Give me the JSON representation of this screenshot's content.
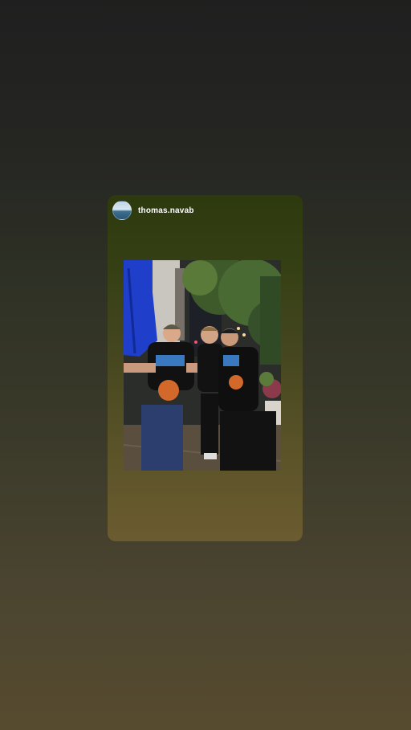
{
  "story": {
    "username": "thomas.navab",
    "avatar_icon": "ocean-avatar-icon",
    "photo_description_icon": "group-photo-image"
  },
  "colors": {
    "background_top": "#1f1f1f",
    "background_bottom": "#574b2f",
    "card_top": "#2d3a0e",
    "card_bottom": "#6b5c30"
  }
}
